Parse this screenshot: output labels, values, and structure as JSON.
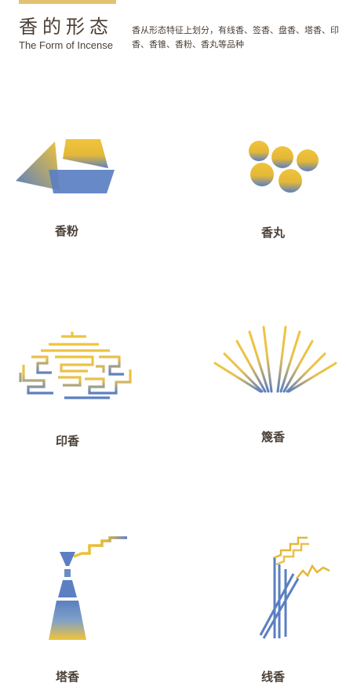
{
  "header": {
    "title": "香的形态",
    "subtitle": "The Form of Incense",
    "description": "香从形态特征上划分，有线香、签香、盘香、塔香、印香、香锥、香粉、香丸等品种"
  },
  "items": [
    {
      "label": "香粉",
      "icon": "incense-powder-icon"
    },
    {
      "label": "香丸",
      "icon": "incense-pill-icon"
    },
    {
      "label": "印香",
      "icon": "seal-incense-icon"
    },
    {
      "label": "篾香",
      "icon": "bamboo-incense-icon"
    },
    {
      "label": "塔香",
      "icon": "tower-incense-icon"
    },
    {
      "label": "线香",
      "icon": "stick-incense-icon"
    }
  ],
  "colors": {
    "gold": "#e8b830",
    "blue": "#5a7fc0",
    "text": "#4a3f36",
    "bar": "#e2c272"
  }
}
